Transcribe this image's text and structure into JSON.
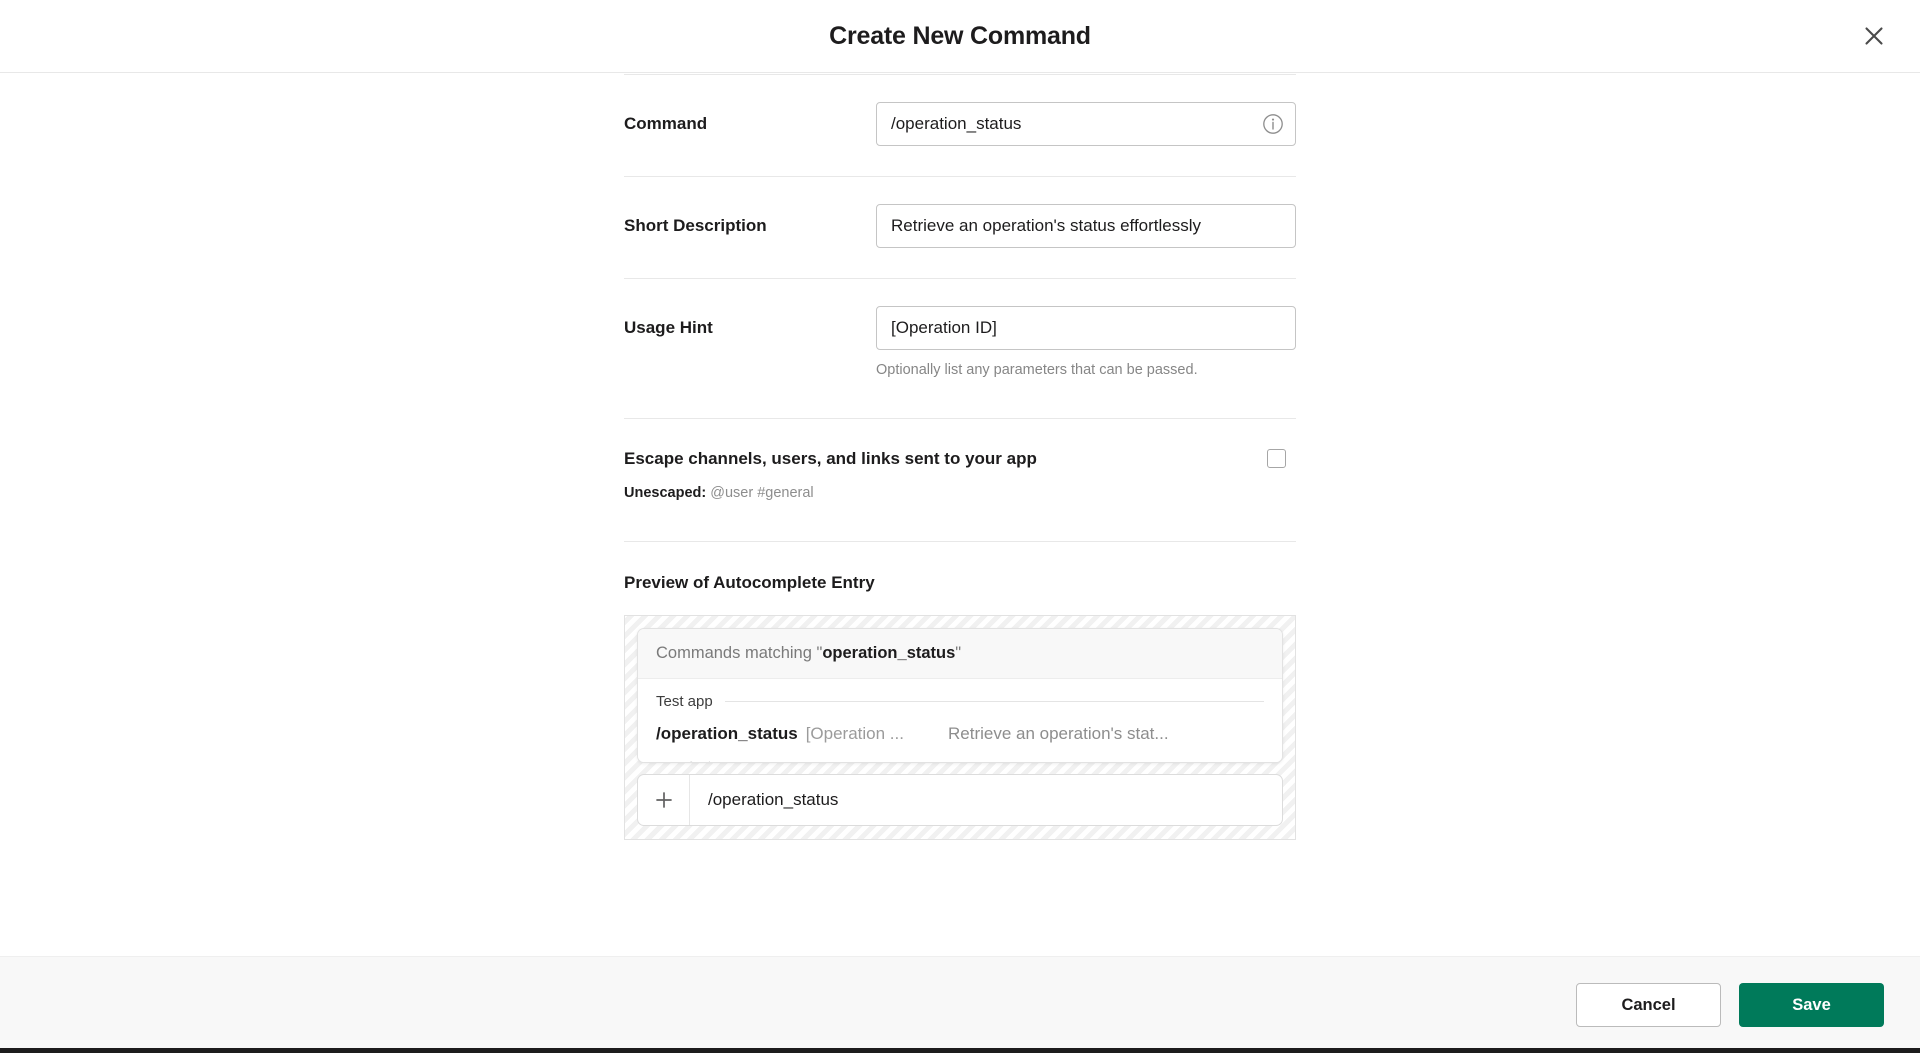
{
  "dialog": {
    "title": "Create New Command",
    "close_icon": "close-icon"
  },
  "fields": {
    "command": {
      "label": "Command",
      "value": "/operation_status",
      "placeholder": "/command",
      "info_icon": "info-circle-icon"
    },
    "short_description": {
      "label": "Short Description",
      "value": "Retrieve an operation's status effortlessly",
      "placeholder": "Short Description"
    },
    "usage_hint": {
      "label": "Usage Hint",
      "value": "[Operation ID]",
      "placeholder": "Usage Hint",
      "help": "Optionally list any parameters that can be passed."
    }
  },
  "escape": {
    "title": "Escape channels, users, and links sent to your app",
    "checked": false,
    "sub_label": "Unescaped:",
    "sub_value": "@user #general"
  },
  "preview": {
    "title": "Preview of Autocomplete Entry",
    "autocomplete": {
      "header_prefix": "Commands matching \"",
      "header_term": "operation_status",
      "header_suffix": "\"",
      "group_label": "Test app",
      "item": {
        "command": "/operation_status",
        "hint": "[Operation ...",
        "description": "Retrieve an operation's stat..."
      }
    },
    "message_box": {
      "plus_icon": "plus-icon",
      "text": "/operation_status"
    }
  },
  "footer": {
    "cancel_label": "Cancel",
    "save_label": "Save"
  },
  "colors": {
    "accent_green": "#007a5a",
    "text_primary": "#1d1c1d",
    "text_muted": "#868686",
    "border": "#c5c5c5",
    "footer_bg": "#f8f8f8"
  }
}
